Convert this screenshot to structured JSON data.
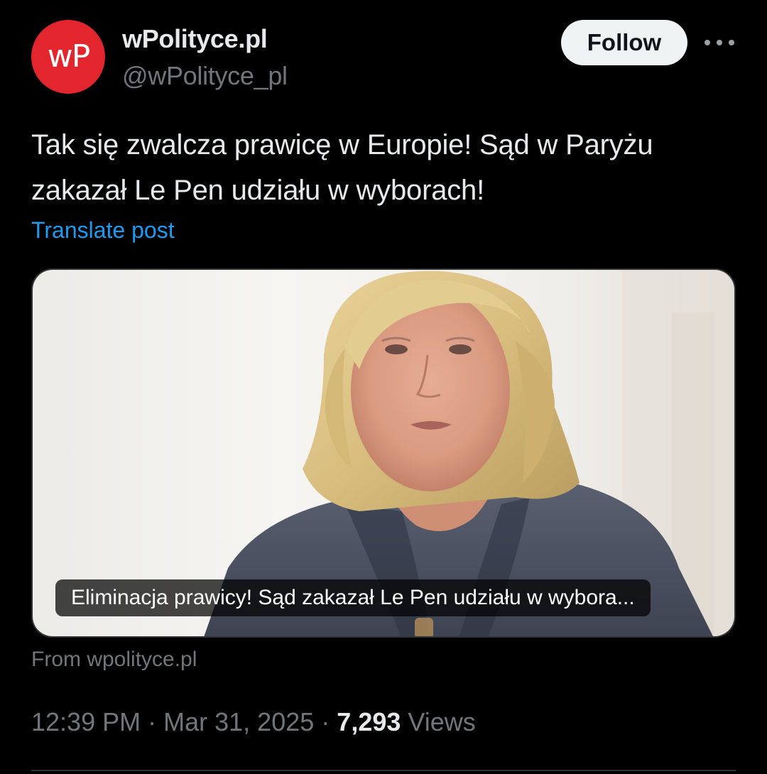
{
  "author": {
    "avatar_text": "wP",
    "display_name": "wPolityce.pl",
    "handle": "@wPolityce_pl",
    "brand_color": "#e3262d"
  },
  "actions": {
    "follow_label": "Follow",
    "more_icon": "more-horizontal-icon"
  },
  "post": {
    "text": "Tak się zwalcza prawicę w Europie! Sąd w Paryżu zakazał Le Pen udziału w wyborach!",
    "translate_label": "Translate post"
  },
  "link_card": {
    "caption": "Eliminacja prawicy! Sąd zakazał Le Pen udziału w wybora...",
    "source": "From wpolityce.pl"
  },
  "meta": {
    "time": "12:39 PM",
    "separator": "·",
    "date": "Mar 31, 2025",
    "views_count": "7,293",
    "views_label": "Views"
  },
  "colors": {
    "background": "#000000",
    "text": "#e7e9ea",
    "secondary": "#71767b",
    "link": "#1d9bf0"
  }
}
